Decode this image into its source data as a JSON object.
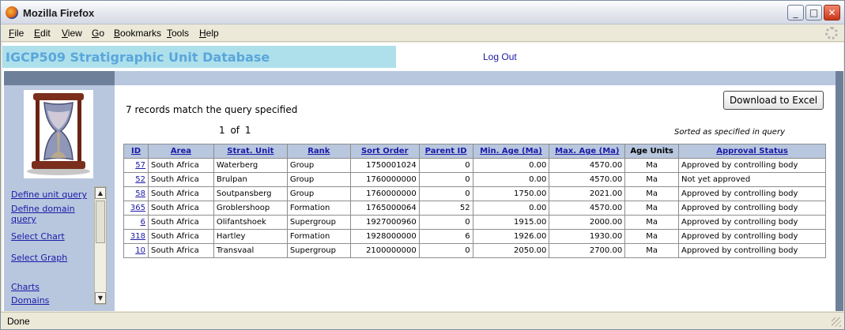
{
  "window": {
    "title": "Mozilla Firefox"
  },
  "menu": [
    "File",
    "Edit",
    "View",
    "Go",
    "Bookmarks",
    "Tools",
    "Help"
  ],
  "app": {
    "title": "IGCP509 Stratigraphic Unit Database",
    "logout_label": "Log Out"
  },
  "nav": {
    "links": [
      "Define unit query",
      "Define domain query",
      "Select Chart",
      "Select Graph",
      "Charts",
      "Domains"
    ]
  },
  "results": {
    "count_text": "7 records match the query specified",
    "download_label": "Download to Excel",
    "pagination": "1 of 1",
    "sort_note": "Sorted as specified in query",
    "columns": [
      "ID",
      "Area",
      "Strat. Unit",
      "Rank",
      "Sort Order",
      "Parent ID",
      "Min. Age (Ma)",
      "Max. Age (Ma)",
      "Age Units",
      "Approval Status"
    ],
    "rows": [
      [
        "57",
        "South Africa",
        "Waterberg",
        "Group",
        "1750001024",
        "0",
        "0.00",
        "4570.00",
        "Ma",
        "Approved by controlling body"
      ],
      [
        "52",
        "South Africa",
        "Brulpan",
        "Group",
        "1760000000",
        "0",
        "0.00",
        "4570.00",
        "Ma",
        "Not yet approved"
      ],
      [
        "58",
        "South Africa",
        "Soutpansberg",
        "Group",
        "1760000000",
        "0",
        "1750.00",
        "2021.00",
        "Ma",
        "Approved by controlling body"
      ],
      [
        "365",
        "South Africa",
        "Groblershoop",
        "Formation",
        "1765000064",
        "52",
        "0.00",
        "4570.00",
        "Ma",
        "Approved by controlling body"
      ],
      [
        "6",
        "South Africa",
        "Olifantshoek",
        "Supergroup",
        "1927000960",
        "0",
        "1915.00",
        "2000.00",
        "Ma",
        "Approved by controlling body"
      ],
      [
        "318",
        "South Africa",
        "Hartley",
        "Formation",
        "1928000000",
        "6",
        "1926.00",
        "1930.00",
        "Ma",
        "Approved by controlling body"
      ],
      [
        "10",
        "South Africa",
        "Transvaal",
        "Supergroup",
        "2100000000",
        "0",
        "2050.00",
        "2700.00",
        "Ma",
        "Approved by controlling body"
      ]
    ]
  },
  "status": {
    "text": "Done"
  },
  "icons": {
    "browser": "firefox-icon",
    "logo": "hourglass-icon",
    "activity": "throbber-icon"
  }
}
